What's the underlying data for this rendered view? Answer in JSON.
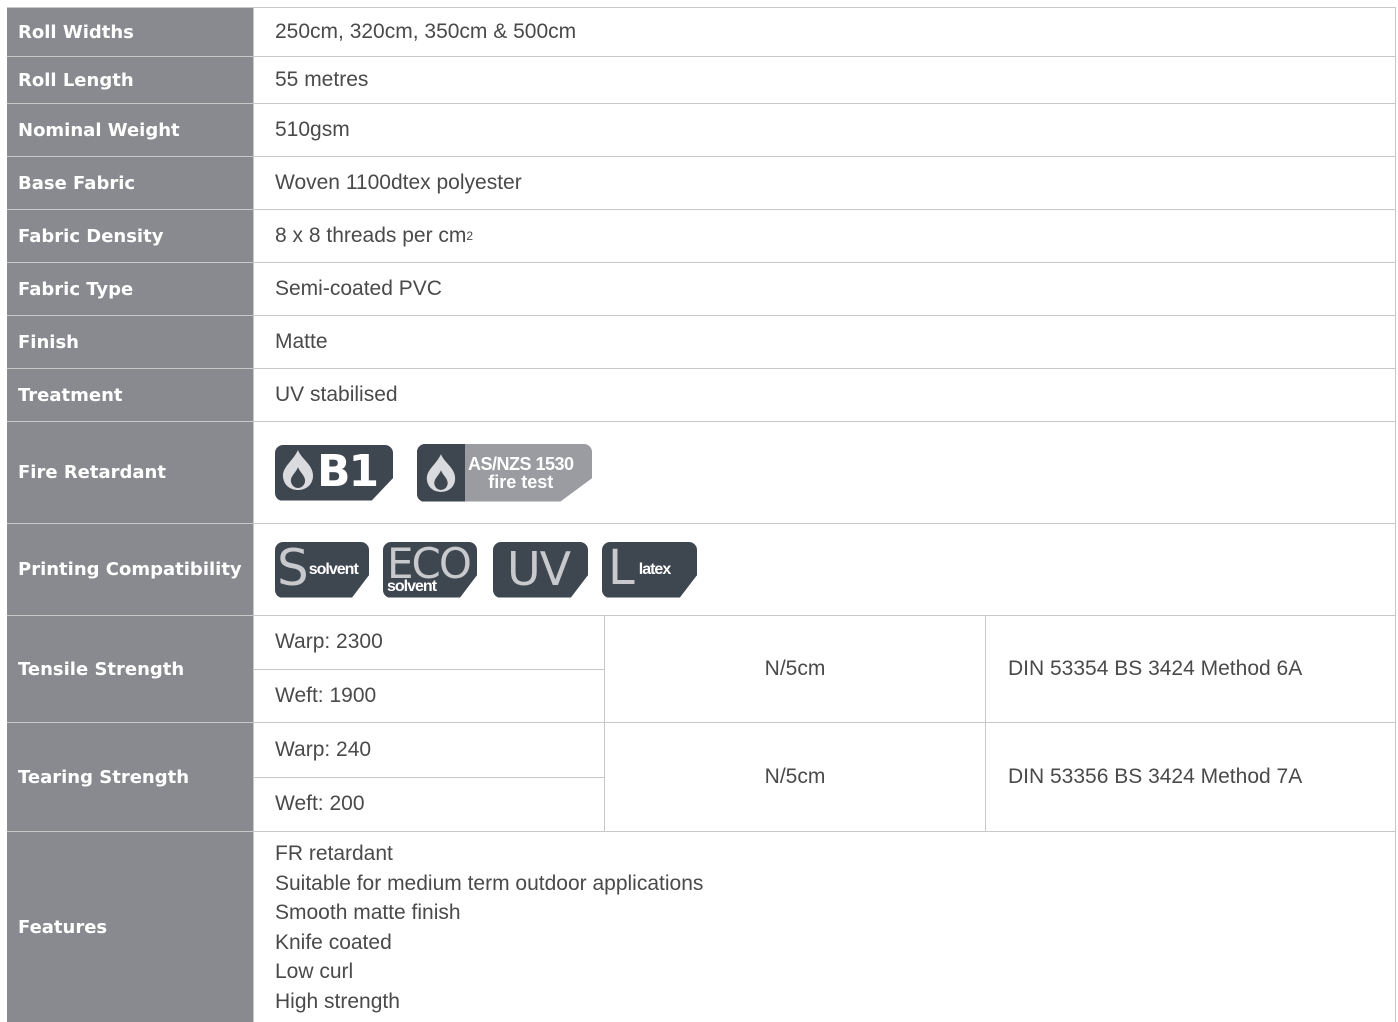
{
  "rows": {
    "roll_widths": {
      "label": "Roll Widths",
      "value": "250cm, 320cm, 350cm & 500cm"
    },
    "roll_length": {
      "label": "Roll Length",
      "value": "55 metres"
    },
    "nominal_weight": {
      "label": "Nominal Weight",
      "value": "510gsm"
    },
    "base_fabric": {
      "label": "Base Fabric",
      "value": "Woven 1100dtex polyester"
    },
    "fabric_density": {
      "label": "Fabric Density",
      "value": "8 x 8 threads per cm",
      "superscript": "2"
    },
    "fabric_type": {
      "label": "Fabric Type",
      "value": "Semi-coated PVC"
    },
    "finish": {
      "label": "Finish",
      "value": "Matte"
    },
    "treatment": {
      "label": "Treatment",
      "value": "UV stabilised"
    },
    "fire_retardant": {
      "label": "Fire Retardant",
      "badge_b1": "B1",
      "badge_asnzs_line1": "AS/NZS 1530",
      "badge_asnzs_line2": "fire test"
    },
    "printing": {
      "label": "Printing Compatibility",
      "solvent_big": "S",
      "solvent_small": "solvent",
      "eco_big": "ECO",
      "eco_small": "solvent",
      "uv": "UV",
      "latex_big": "L",
      "latex_small": "latex"
    },
    "tensile": {
      "label": "Tensile Strength",
      "warp": "Warp: 2300",
      "weft": "Weft: 1900",
      "unit": "N/5cm",
      "method": "DIN 53354 BS 3424 Method 6A"
    },
    "tearing": {
      "label": "Tearing Strength",
      "warp": "Warp: 240",
      "weft": "Weft: 200",
      "unit": "N/5cm",
      "method": "DIN 53356 BS 3424 Method 7A"
    },
    "features": {
      "label": "Features",
      "items": [
        "FR retardant",
        "Suitable for medium term outdoor applications",
        "Smooth matte finish",
        "Knife coated",
        "Low curl",
        "High strength"
      ]
    }
  },
  "colors": {
    "label_bg": "#898a8f",
    "badge_dark": "#3e4650",
    "badge_light": "#9a9ca1",
    "border": "#c8c8c8",
    "text": "#4a4a4a"
  },
  "icons": {
    "fire": "flame-icon"
  }
}
